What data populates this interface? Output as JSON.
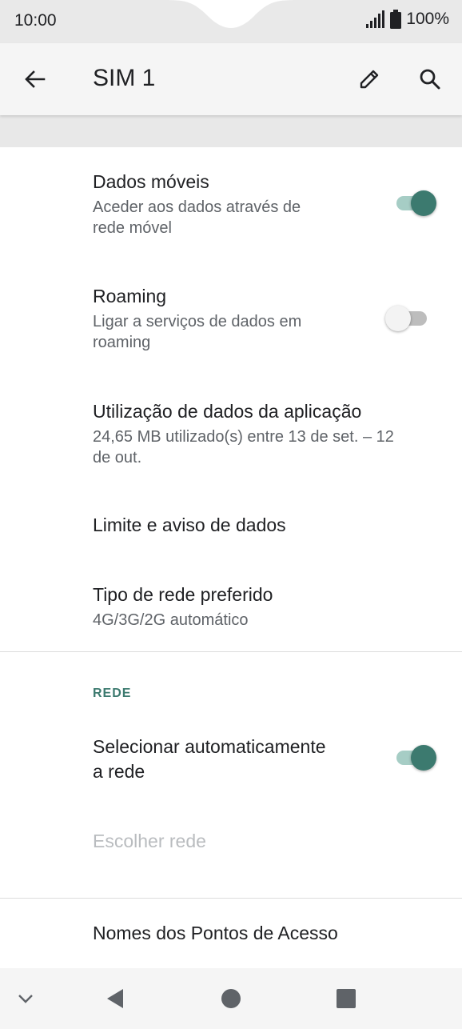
{
  "status_bar": {
    "time": "10:00",
    "battery_percent": "100%"
  },
  "app_bar": {
    "title": "SIM 1",
    "icons": [
      "back-arrow-icon",
      "pencil-icon",
      "search-icon"
    ]
  },
  "settings": {
    "mobile_data": {
      "title": "Dados móveis",
      "subtitle_line1": "Aceder aos dados através de",
      "subtitle_line2": "rede móvel",
      "enabled": true
    },
    "roaming": {
      "title": "Roaming",
      "subtitle_line1": "Ligar a serviços de dados em",
      "subtitle_line2": "roaming",
      "enabled": false
    },
    "app_data_usage": {
      "title": "Utilização de dados da aplicação",
      "subtitle_line1": "24,65 MB utilizado(s) entre 13 de set. – 12",
      "subtitle_line2": "de out."
    },
    "data_limit": {
      "title": "Limite e aviso de dados"
    },
    "preferred_network": {
      "title": "Tipo de rede preferido",
      "subtitle": "4G/3G/2G automático"
    }
  },
  "network_section": {
    "header": "REDE",
    "auto_select": {
      "title_line1": "Selecionar automaticamente",
      "title_line2": "a rede",
      "enabled": true
    },
    "choose_network": {
      "title": "Escolher rede",
      "disabled": true
    }
  },
  "apn": {
    "title": "Nomes dos Pontos de Acesso"
  },
  "nav_bar": {
    "icons": [
      "chevron-down-icon",
      "back-triangle-icon",
      "home-circle-icon",
      "recents-square-icon"
    ]
  },
  "colors": {
    "accent": "#3c7a6f",
    "accent_track": "#a6cdc5",
    "status_bar_bg": "#e9e9e9",
    "app_bar_bg": "#f5f5f5"
  }
}
